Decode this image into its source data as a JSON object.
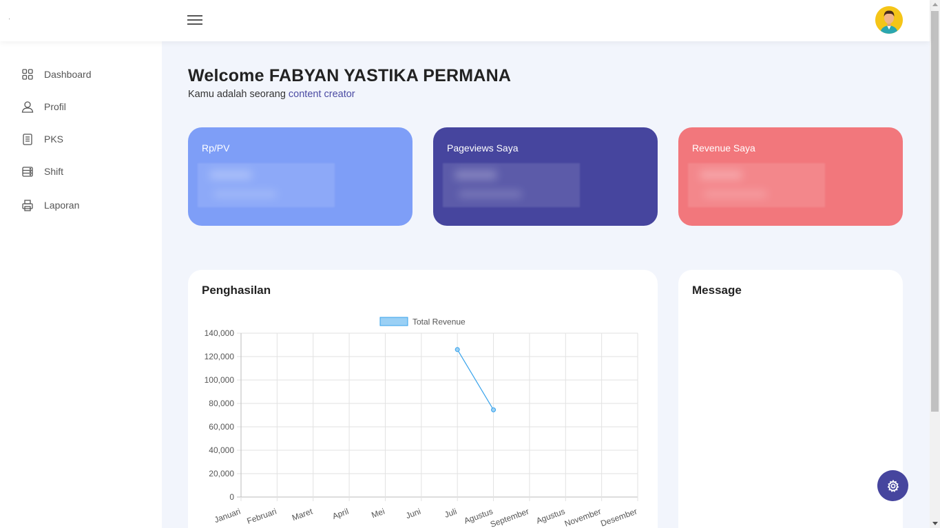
{
  "header": {
    "menu_icon": "hamburger-icon",
    "avatar_icon": "user-avatar"
  },
  "sidebar": {
    "items": [
      {
        "label": "Dashboard",
        "icon": "grid-icon"
      },
      {
        "label": "Profil",
        "icon": "user-icon"
      },
      {
        "label": "PKS",
        "icon": "document-icon"
      },
      {
        "label": "Shift",
        "icon": "server-icon"
      },
      {
        "label": "Laporan",
        "icon": "printer-icon"
      }
    ]
  },
  "main": {
    "welcome": "Welcome FABYAN YASTIKA PERMANA",
    "subtitle_prefix": "Kamu adalah seorang ",
    "subtitle_role": "content creator",
    "cards": [
      {
        "title": "Rp/PV",
        "color": "#7e9ef7"
      },
      {
        "title": "Pageviews Saya",
        "color": "#46459e"
      },
      {
        "title": "Revenue Saya",
        "color": "#f2777c"
      }
    ],
    "chart_panel_title": "Penghasilan",
    "message_panel_title": "Message"
  },
  "fab_icon": "gear-icon",
  "chart_data": {
    "type": "line",
    "categories": [
      "Januari",
      "Februari",
      "Maret",
      "April",
      "Mei",
      "Juni",
      "Juli",
      "Agustus",
      "September",
      "Agustus",
      "November",
      "Desember"
    ],
    "series": [
      {
        "name": "Total Revenue",
        "values": [
          null,
          null,
          null,
          null,
          null,
          null,
          126000,
          74500,
          null,
          null,
          null,
          null
        ],
        "color": "#36a2eb",
        "fill": "#9ad0f5"
      }
    ],
    "ylim": [
      0,
      140000
    ],
    "yticks": [
      "140,000",
      "120,000",
      "100,000",
      "80,000",
      "60,000",
      "40,000",
      "20,000",
      "0"
    ],
    "ytick_values": [
      140000,
      120000,
      100000,
      80000,
      60000,
      40000,
      20000,
      0
    ],
    "grid": true,
    "legend": "top"
  }
}
